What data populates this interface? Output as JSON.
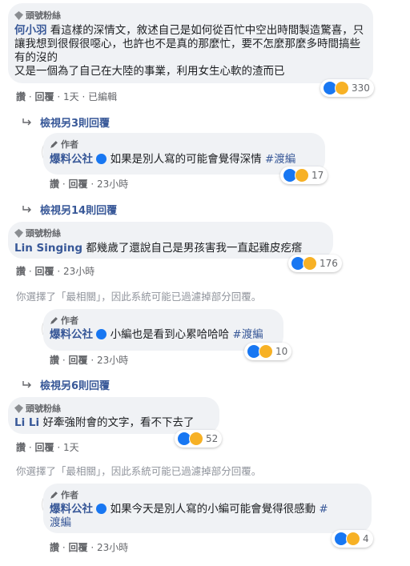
{
  "badge_top_fan": "頭號粉絲",
  "author_tag": "作者",
  "comments": [
    {
      "name": "何小羽",
      "text": " 看這樣的深情文，敘述自己是如何從百忙中空出時間製造驚喜，只讓我想到很假很噁心，也許也不是真的那麼忙，要不怎麼那麼多時間搞些有的沒的",
      "line2": "又是一個為了自己在大陸的事業，利用女生心軟的渣而已",
      "actions": [
        "讚",
        "回覆",
        "1天",
        "已編輯"
      ],
      "reactions": "330"
    },
    {
      "name": "Lin Singing",
      "text": " 都幾歲了還說自己是男孩害我一直起雞皮疙瘩",
      "actions": [
        "讚",
        "回覆",
        "23小時"
      ],
      "reactions": "176"
    },
    {
      "name": "Li Li",
      "text": " 好牽強附會的文字，看不下去了",
      "actions": [
        "讚",
        "回覆",
        "1天"
      ],
      "reactions": "52"
    }
  ],
  "replies": [
    {
      "view_more": "檢視另3則回覆",
      "name": "爆料公社",
      "text": " 如果是別人寫的可能會覺得深情 ",
      "hashtag": "#渡編",
      "actions": [
        "讚",
        "回覆",
        "23小時"
      ],
      "reactions": "17"
    },
    {
      "view_more": "檢視另14則回覆"
    },
    {
      "name": "爆料公社",
      "text": " 小編也是看到心累哈哈哈 ",
      "hashtag": "#渡編",
      "actions": [
        "讚",
        "回覆",
        "23小時"
      ],
      "reactions": "10"
    },
    {
      "view_more": "檢視另6則回覆"
    },
    {
      "name": "爆料公社",
      "text": " 如果今天是別人寫的小編可能會覺得很感動 ",
      "hashtag": "#",
      "hashtag2": "渡編",
      "actions": [
        "讚",
        "回覆",
        "23小時"
      ],
      "reactions": "4"
    }
  ],
  "filter_note": "你選擇了「最相關」，因此系統可能已過濾掉部分回覆。",
  "avatar_text": "爆",
  "sep": "·"
}
